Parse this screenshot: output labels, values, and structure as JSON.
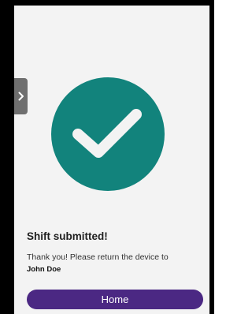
{
  "status": {
    "title": "Shift submitted!",
    "message": "Thank you! Please return the device to",
    "recipient_name": "John Doe",
    "icon": "checkmark-circle-icon"
  },
  "actions": {
    "home_label": "Home"
  },
  "colors": {
    "accent_teal": "#12837c",
    "button_purple": "#4b2883",
    "background": "#f3f3f3"
  }
}
